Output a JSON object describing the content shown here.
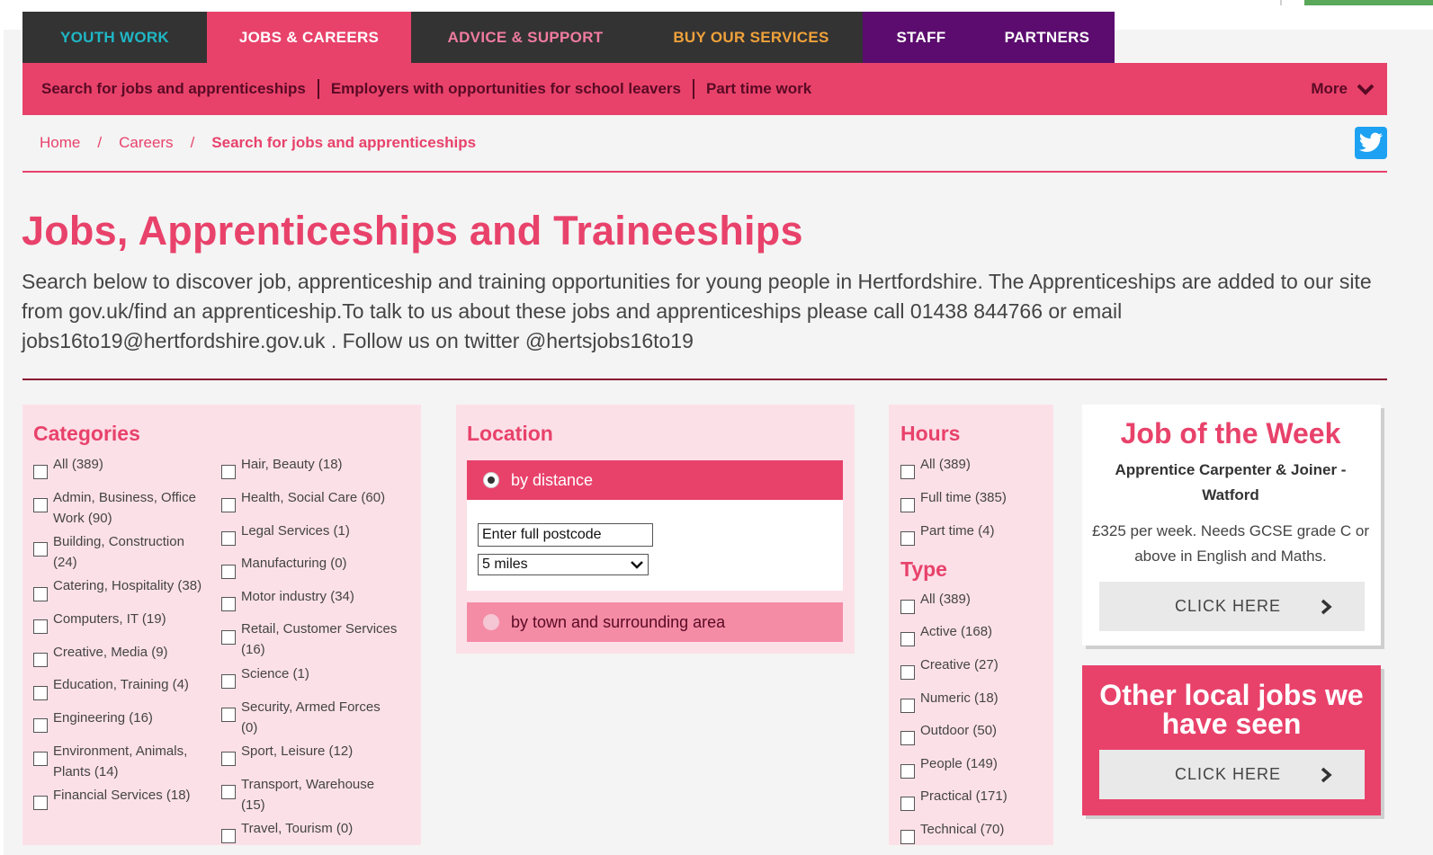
{
  "nav": {
    "youth": "YOUTH WORK",
    "jobs": "JOBS & CAREERS",
    "advice": "ADVICE & SUPPORT",
    "buy": "BUY OUR SERVICES",
    "staff": "STAFF",
    "partners": "PARTNERS"
  },
  "subnav": {
    "link1": "Search for jobs and apprenticeships",
    "link2": "Employers with opportunities for school leavers",
    "link3": "Part time work",
    "more": "More"
  },
  "breadcrumb": {
    "home": "Home",
    "careers": "Careers",
    "current": "Search for jobs and apprenticeships"
  },
  "page": {
    "title": "Jobs, Apprenticeships and Traineeships",
    "intro": "Search below to discover job, apprenticeship and training opportunities for young people in Hertfordshire. The Apprenticeships are added to our site from gov.uk/find an apprenticeship.To talk to us about these jobs and apprenticeships please call 01438 844766 or email jobs16to19@hertfordshire.gov.uk . Follow us on twitter @hertsjobs16to19"
  },
  "categories": {
    "heading": "Categories",
    "col1": [
      "All (389)",
      "Admin, Business, Office Work (90)",
      "Building, Construction  (24)",
      "Catering, Hospitality (38)",
      "Computers, IT (19)",
      "Creative, Media (9)",
      "Education, Training (4)",
      "Engineering (16)",
      "Environment, Animals, Plants (14)",
      "Financial Services (18)"
    ],
    "col2": [
      "Hair, Beauty (18)",
      "Health, Social Care (60)",
      "Legal Services (1)",
      "Manufacturing (0)",
      "Motor industry (34)",
      "Retail, Customer Services (16)",
      "Science (1)",
      "Security, Armed Forces  (0)",
      "Sport, Leisure (12)",
      "Transport, Warehouse  (15)",
      "Travel, Tourism (0)"
    ]
  },
  "location": {
    "heading": "Location",
    "by_distance": "by distance",
    "postcode_value": "Enter full postcode",
    "miles_value": "5 miles",
    "by_town": "by town and surrounding area"
  },
  "hours": {
    "heading": "Hours",
    "items": [
      "All (389)",
      "Full time (385)",
      "Part time (4)"
    ]
  },
  "type": {
    "heading": "Type",
    "items": [
      "All (389)",
      "Active (168)",
      "Creative (27)",
      "Numeric (18)",
      "Outdoor (50)",
      "People (149)",
      "Practical (171)",
      "Technical (70)"
    ]
  },
  "job_of_week": {
    "title": "Job of the Week",
    "subtitle": "Apprentice Carpenter & Joiner - Watford",
    "description": "£325 per week. Needs GCSE grade C or above in English and Maths.",
    "button": "CLICK HERE"
  },
  "other_jobs": {
    "title": "Other local jobs we have seen",
    "button": "CLICK HERE"
  },
  "colors": {
    "accent": "#e8426b",
    "dark_nav": "#333333",
    "purple_nav": "#5b0c6e",
    "panel_bg": "#fce0e8"
  }
}
